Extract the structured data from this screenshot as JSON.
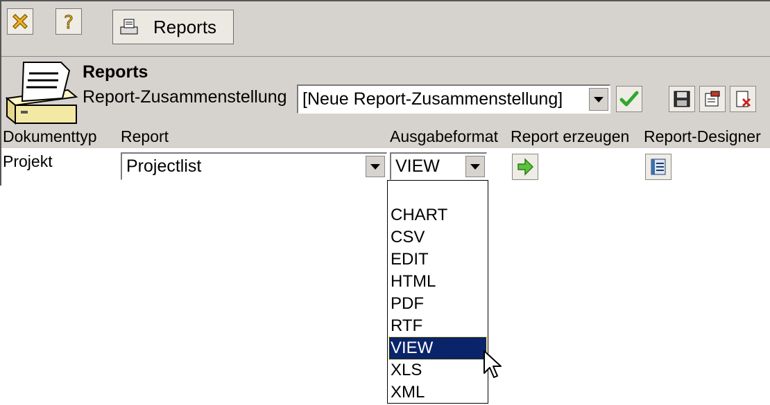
{
  "toolbar": {
    "close_icon": "close-x-icon",
    "help_icon": "help-question-icon",
    "tab_label": "Reports"
  },
  "header": {
    "title": "Reports",
    "compilation_label": "Report-Zusammenstellung",
    "compilation_value": "[Neue Report-Zusammenstellung]"
  },
  "table": {
    "columns": [
      "Dokumenttyp",
      "Report",
      "Ausgabeformat",
      "Report erzeugen",
      "Report-Designer"
    ],
    "rows": [
      {
        "doctype": "Projekt",
        "report": "Projectlist",
        "format": "VIEW"
      }
    ]
  },
  "format_dropdown": {
    "options": [
      "",
      "CHART",
      "CSV",
      "EDIT",
      "HTML",
      "PDF",
      "RTF",
      "VIEW",
      "XLS",
      "XML"
    ],
    "selected": "VIEW"
  },
  "colors": {
    "chrome": "#d6d3ce",
    "selection": "#0a246a",
    "ok_green": "#2ea82e"
  }
}
